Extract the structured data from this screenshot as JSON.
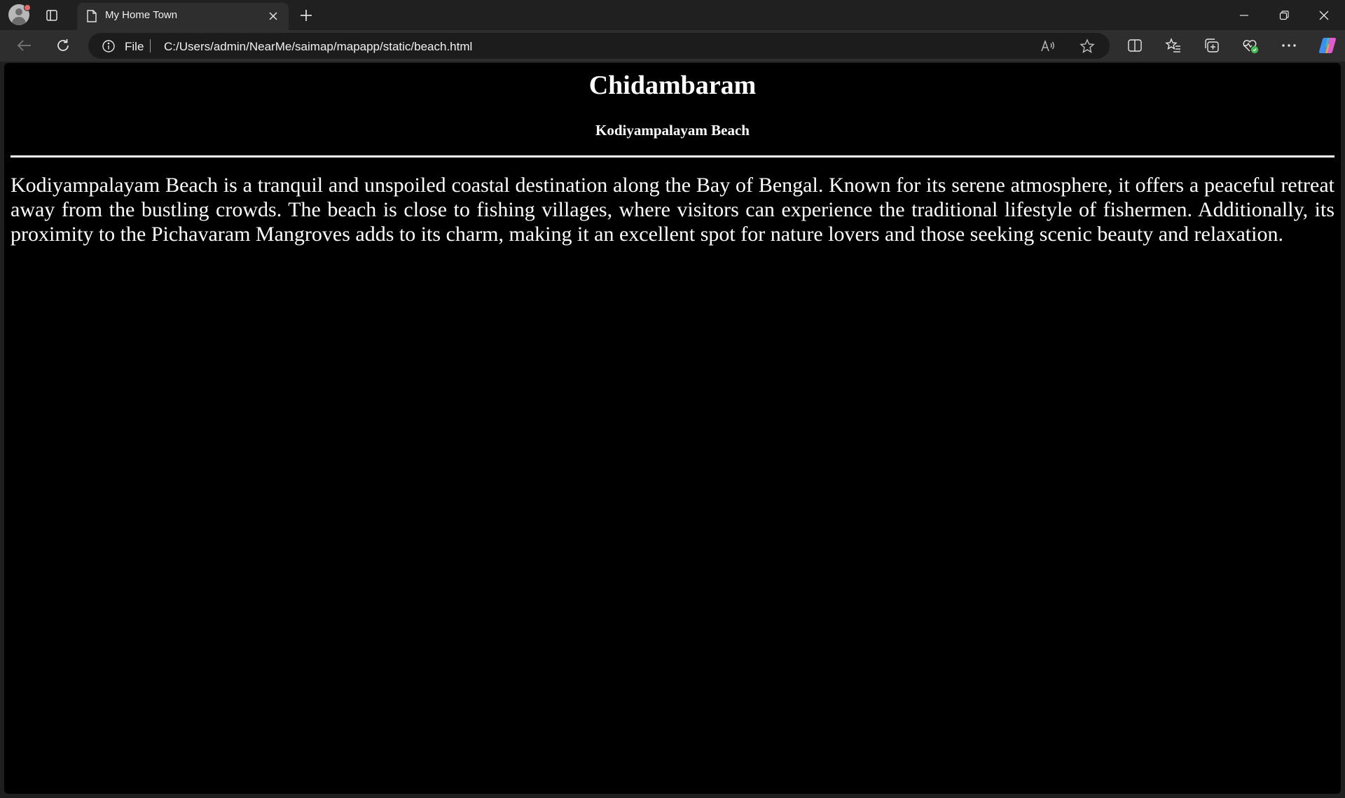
{
  "browser": {
    "tab": {
      "title": "My Home Town"
    },
    "address_bar": {
      "scheme_label": "File",
      "url": "C:/Users/admin/NearMe/saimap/mapapp/static/beach.html"
    },
    "icons": [
      "profile-avatar",
      "tab-actions-icon",
      "page-icon",
      "close-icon",
      "plus-icon",
      "minimize-icon",
      "restore-icon",
      "close-icon",
      "back-arrow-icon",
      "reload-icon",
      "info-icon",
      "read-aloud-icon",
      "star-icon",
      "split-screen-icon",
      "favorites-icon",
      "collections-icon",
      "browser-essentials-icon",
      "more-icon",
      "copilot-icon"
    ]
  },
  "page": {
    "background": "#000000",
    "text_color": "#ffffff",
    "heading": "Chidambaram",
    "subheading": "Kodiyampalayam Beach",
    "paragraph": "Kodiyampalayam Beach is a tranquil and unspoiled coastal destination along the Bay of Bengal. Known for its serene atmosphere, it offers a peaceful retreat away from the bustling crowds. The beach is close to fishing villages, where visitors can experience the traditional lifestyle of fishermen. Additionally, its proximity to the Pichavaram Mangroves adds to its charm, making it an excellent spot for nature lovers and those seeking scenic beauty and relaxation."
  }
}
